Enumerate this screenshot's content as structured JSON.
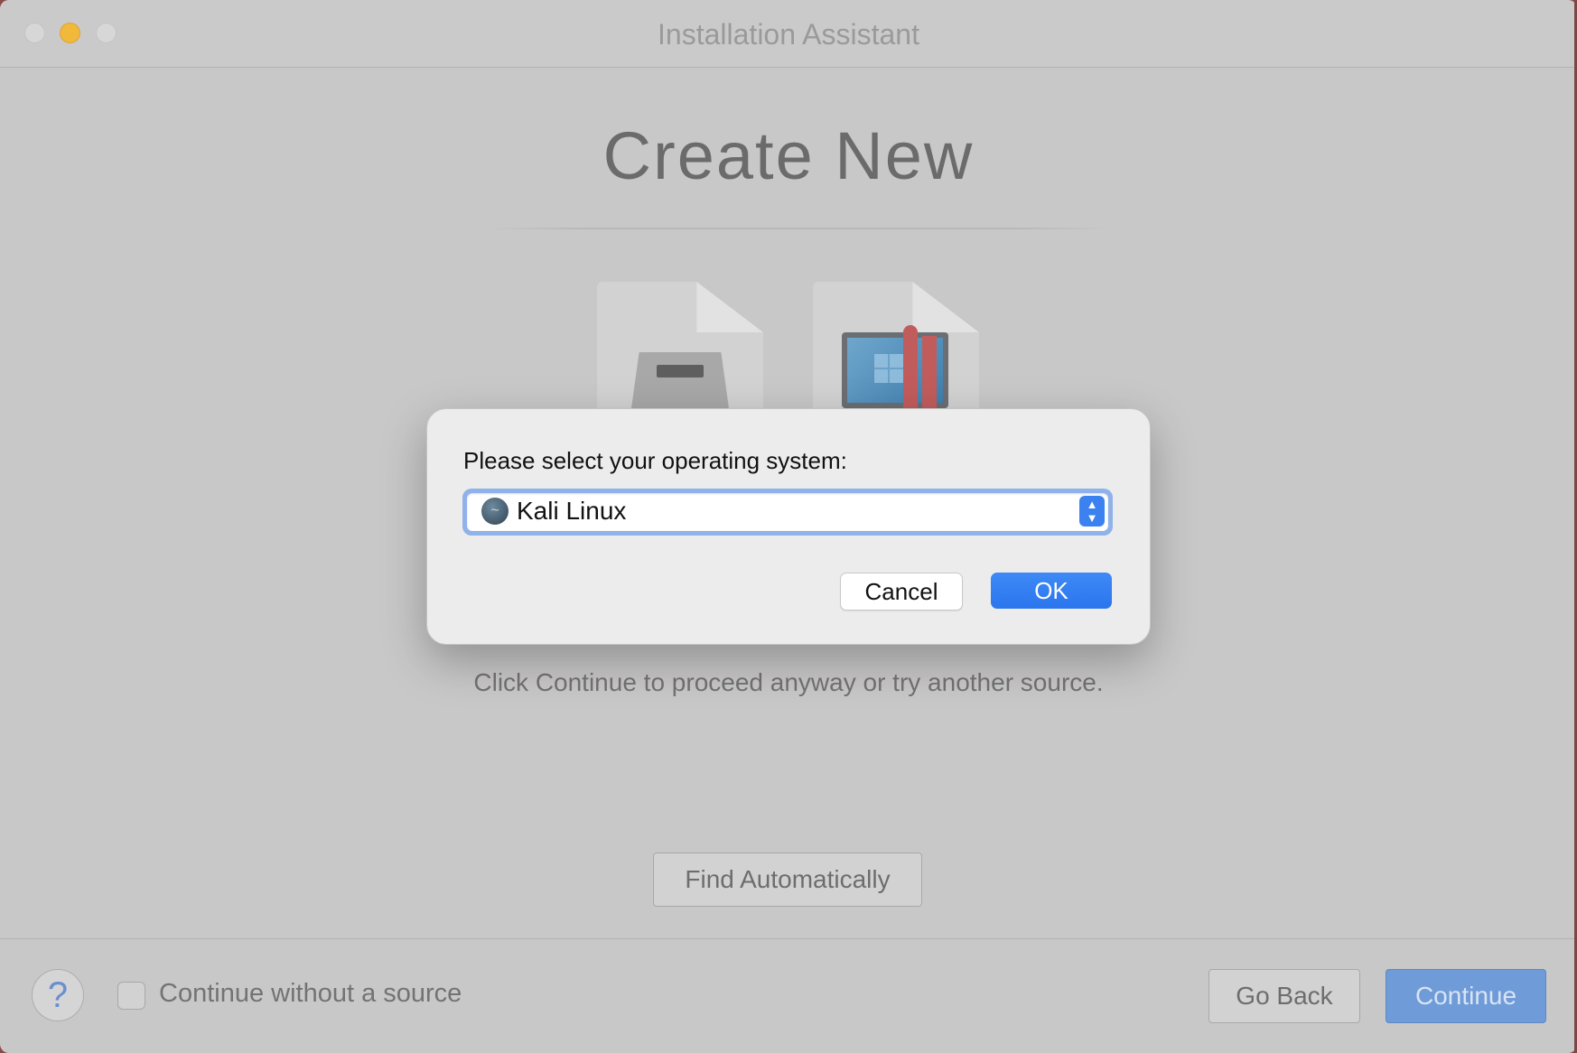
{
  "window": {
    "title": "Installation Assistant"
  },
  "main": {
    "heading": "Create New",
    "info_text": "Click Continue to proceed anyway or try another source.",
    "find_button": "Find Automatically"
  },
  "dialog": {
    "prompt": "Please select your operating system:",
    "selected_os": "Kali Linux",
    "cancel_label": "Cancel",
    "ok_label": "OK"
  },
  "footer": {
    "help_label": "?",
    "checkbox_label": "Continue without a source",
    "checkbox_checked": false,
    "go_back_label": "Go Back",
    "continue_label": "Continue"
  },
  "colors": {
    "accent": "#2b75ee",
    "window_bg": "#c9c8c8",
    "minimize_yellow": "#f1b93a"
  }
}
